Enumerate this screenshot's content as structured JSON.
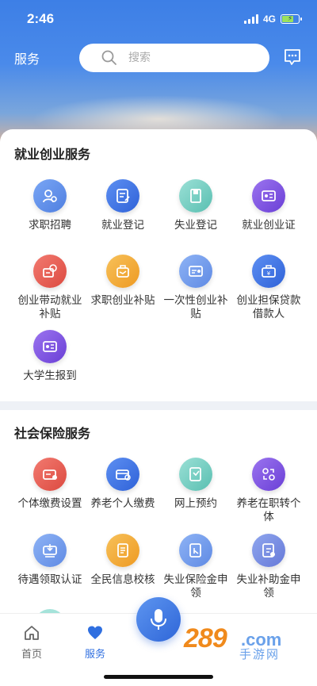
{
  "status": {
    "time": "2:46",
    "network": "4G"
  },
  "header": {
    "title": "服务",
    "search_placeholder": "搜索"
  },
  "section1": {
    "title": "就业创业服务",
    "items": [
      {
        "label": "求职招聘",
        "icon": "job-search-icon",
        "color": "#5f8ae4"
      },
      {
        "label": "就业登记",
        "icon": "employment-registration-icon",
        "color": "#2f62d8"
      },
      {
        "label": "失业登记",
        "icon": "unemployment-registration-icon",
        "color": "#59bfb1"
      },
      {
        "label": "就业创业证",
        "icon": "business-certificate-icon",
        "color": "#6a3fd6"
      },
      {
        "label": "创业带动就业补贴",
        "icon": "subsidy-icon",
        "color": "#dc4a40"
      },
      {
        "label": "求职创业补贴",
        "icon": "handshake-icon",
        "color": "#ee9a22"
      },
      {
        "label": "一次性创业补贴",
        "icon": "card-icon",
        "color": "#5f8ae4"
      },
      {
        "label": "创业担保贷款借款人",
        "icon": "briefcase-icon",
        "color": "#2f62d8"
      },
      {
        "label": "大学生报到",
        "icon": "id-card-icon",
        "color": "#6a3fd6"
      }
    ]
  },
  "section2": {
    "title": "社会保险服务",
    "items": [
      {
        "label": "个体缴费设置",
        "icon": "payment-settings-icon",
        "color": "#dc4a40"
      },
      {
        "label": "养老个人缴费",
        "icon": "pension-payment-icon",
        "color": "#2f62d8"
      },
      {
        "label": "网上预约",
        "icon": "appointment-icon",
        "color": "#59bfb1"
      },
      {
        "label": "养老在职转个体",
        "icon": "transfer-icon",
        "color": "#6a3fd6"
      },
      {
        "label": "待遇领取认证",
        "icon": "certification-icon",
        "color": "#5f8ae4"
      },
      {
        "label": "全民信息校核",
        "icon": "info-check-icon",
        "color": "#ee9a22"
      },
      {
        "label": "失业保险金申领",
        "icon": "unemployment-insurance-icon",
        "color": "#5f8ae4"
      },
      {
        "label": "失业补助金申领",
        "icon": "unemployment-aid-icon",
        "color": "#6679d8"
      }
    ]
  },
  "tabbar": {
    "home": "首页",
    "service": "服务"
  },
  "watermark": {
    "num": "289",
    "com": ".com",
    "sub": "手游网"
  }
}
